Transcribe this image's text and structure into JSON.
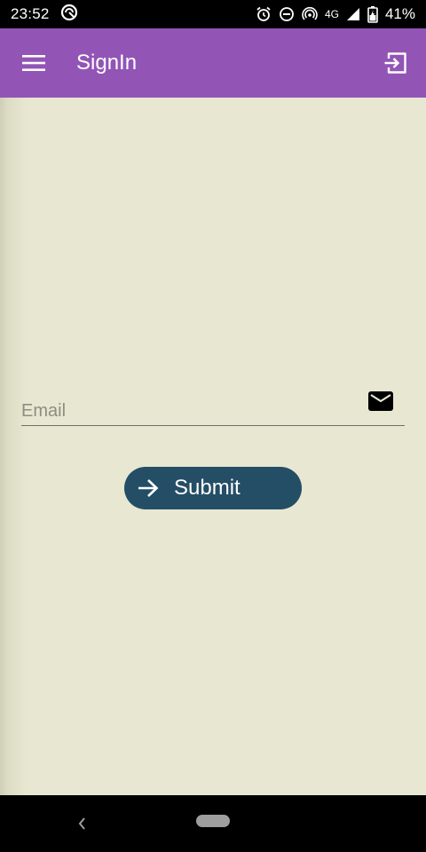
{
  "status_bar": {
    "time": "23:52",
    "network": "4G",
    "battery": "41%"
  },
  "app_bar": {
    "title": "SignIn",
    "background": "#9255b6"
  },
  "form": {
    "email_placeholder": "Email",
    "email_value": "",
    "submit_label": "Submit",
    "button_color": "#244e66"
  },
  "icons": {
    "menu": "hamburger-icon",
    "exit": "exit-to-app-icon",
    "email": "envelope-icon",
    "submit": "arrow-right-icon"
  }
}
